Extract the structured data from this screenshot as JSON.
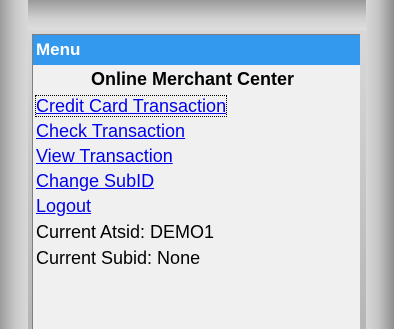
{
  "menu": {
    "title": "Menu",
    "subtitle": "Online Merchant Center",
    "links": [
      "Credit Card Transaction",
      "Check Transaction",
      "View Transaction",
      "Change SubID",
      "Logout"
    ],
    "atsid_label": "Current Atsid: DEMO1",
    "subid_label": "Current Subid: None"
  },
  "colors": {
    "header_bg": "#3399ee",
    "link": "#0000ee",
    "panel_bg": "#f0f0f0"
  }
}
